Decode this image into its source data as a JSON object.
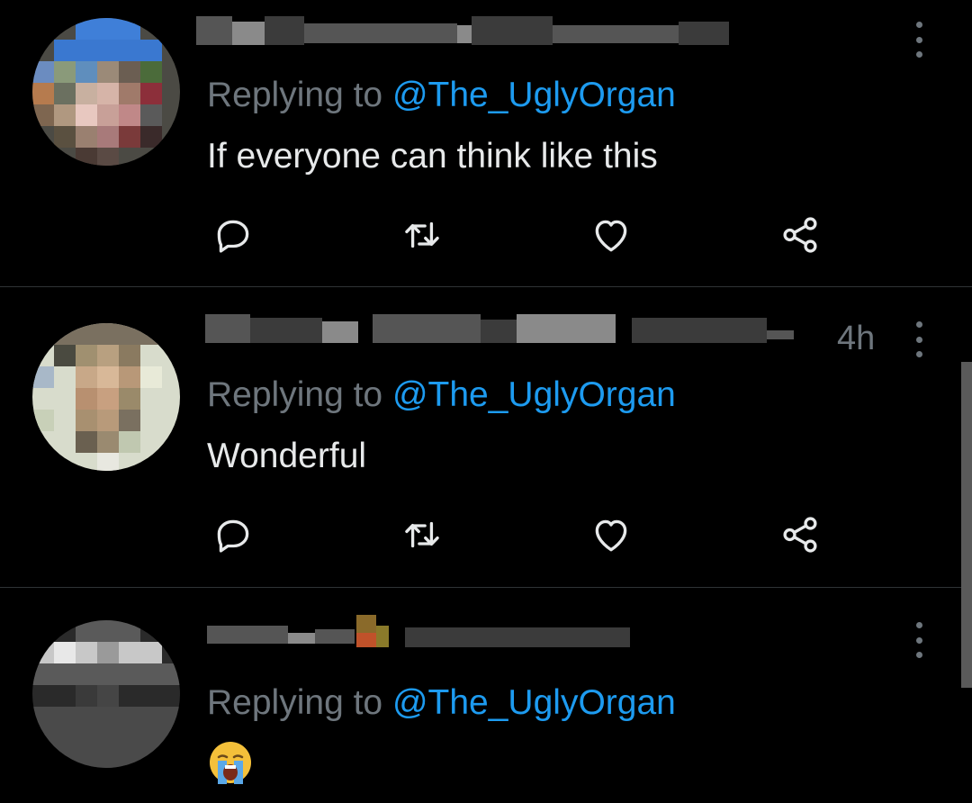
{
  "tweets": [
    {
      "replying_prefix": "Replying to ",
      "replying_handle": "@The_UglyOrgan",
      "text": "If everyone can think like this",
      "timestamp": ""
    },
    {
      "replying_prefix": "Replying to ",
      "replying_handle": "@The_UglyOrgan",
      "text": "Wonderful",
      "timestamp": "4h"
    },
    {
      "replying_prefix": "Replying to ",
      "replying_handle": "@The_UglyOrgan",
      "text": "",
      "emoji": "loudly-crying-face"
    }
  ],
  "icons": {
    "reply": "reply-icon",
    "retweet": "retweet-icon",
    "like": "heart-icon",
    "share": "share-icon",
    "more": "more-icon"
  },
  "colors": {
    "background": "#000000",
    "text": "#e7e9ea",
    "secondary": "#6e767d",
    "link": "#1d9bf0",
    "divider": "#2f3336"
  }
}
